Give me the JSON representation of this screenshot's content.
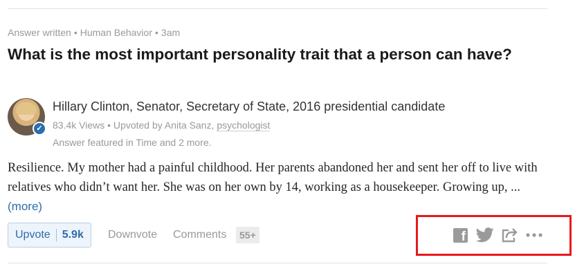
{
  "meta": {
    "type": "Answer written",
    "topic": "Human Behavior",
    "time": "3am",
    "separator": "•"
  },
  "question": "What is the most important personality trait that a person can have?",
  "author": {
    "name": "Hillary Clinton, Senator, Secretary of State, 2016 presidential candidate",
    "views": "83.4k Views",
    "upvoted_by": "Upvoted by Anita Sanz,",
    "upvoter_credential": "psychologist",
    "featured": "Answer featured in Time and 2 more."
  },
  "answer": {
    "text": "Resilience. My mother had a painful childhood. Her parents abandoned her and sent her off to live with relatives who didn’t want her. She was on her own by 14, working as a housekeeper. Growing up, ...",
    "more_label": "(more)"
  },
  "actions": {
    "upvote_label": "Upvote",
    "upvote_count": "5.9k",
    "downvote_label": "Downvote",
    "comments_label": "Comments",
    "comments_count": "55+"
  },
  "icons": {
    "facebook": "facebook-icon",
    "twitter": "twitter-icon",
    "share": "share-icon",
    "more": "more-icon"
  },
  "colors": {
    "link": "#2b6dad",
    "highlight": "#e8171b",
    "muted": "#999999"
  }
}
